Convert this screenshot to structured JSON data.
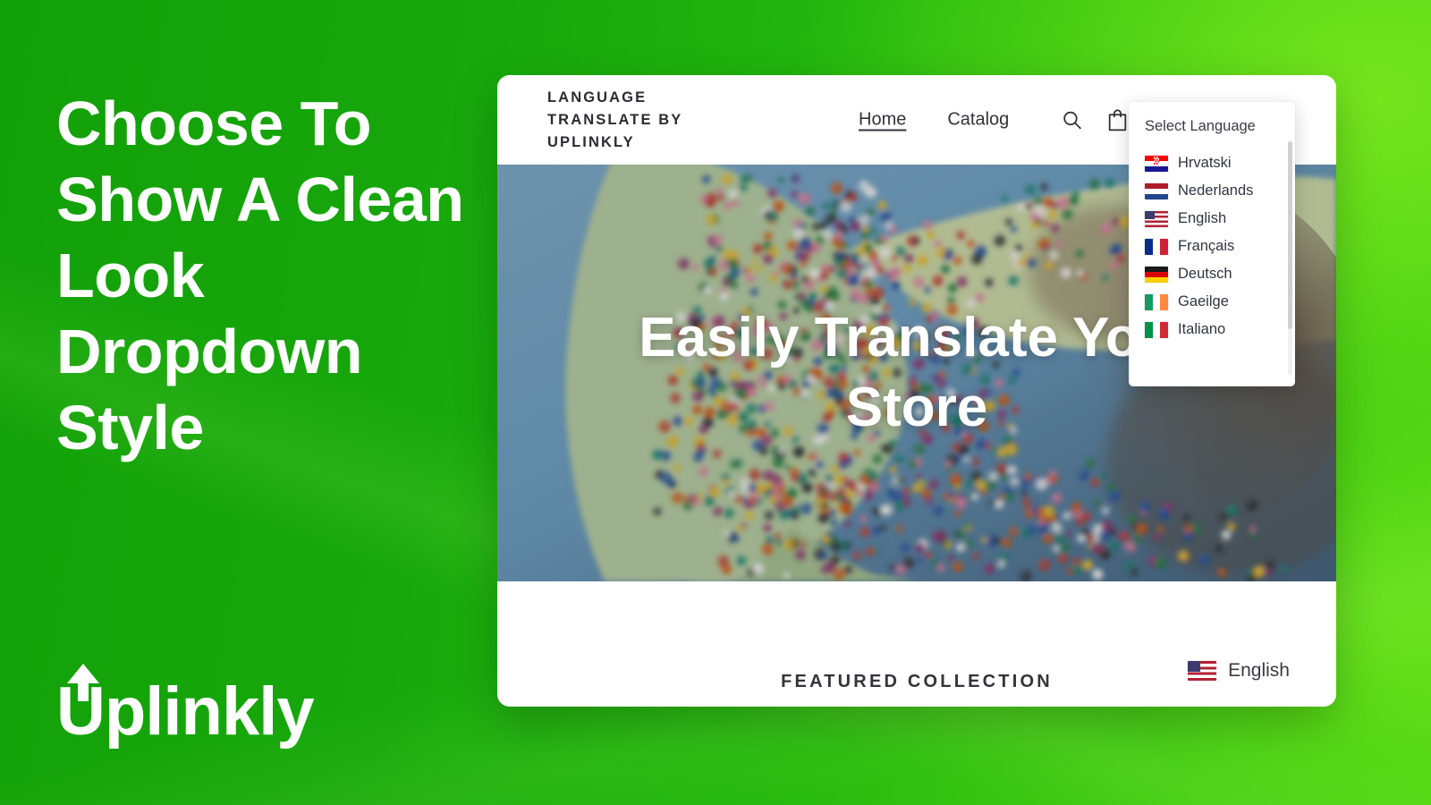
{
  "promo": {
    "headline": "Choose To Show A Clean Look Dropdown Style",
    "brand": "Uplinkly",
    "bg_color_left": "#12a008",
    "bg_color_right": "#55dd15",
    "text_color": "#ffffff"
  },
  "storefront": {
    "title": "LANGUAGE TRANSLATE BY UPLINKLY",
    "nav": [
      {
        "label": "Home",
        "active": true
      },
      {
        "label": "Catalog",
        "active": false
      }
    ],
    "icons": [
      {
        "name": "search-icon"
      },
      {
        "name": "shopping-bag-icon"
      }
    ],
    "hero": {
      "heading": "Easily Translate Your Store",
      "image_alt": "world map covered with colorful pushpins"
    },
    "featured_title": "FEATURED COLLECTION",
    "language_pill": {
      "label": "English",
      "flag": "us"
    }
  },
  "dropdown": {
    "title": "Select Language",
    "items": [
      {
        "label": "Hrvatski",
        "flag": "hr"
      },
      {
        "label": "Nederlands",
        "flag": "nl"
      },
      {
        "label": "English",
        "flag": "us"
      },
      {
        "label": "Français",
        "flag": "fr"
      },
      {
        "label": "Deutsch",
        "flag": "de"
      },
      {
        "label": "Gaeilge",
        "flag": "ie"
      },
      {
        "label": "Italiano",
        "flag": "it"
      }
    ]
  }
}
